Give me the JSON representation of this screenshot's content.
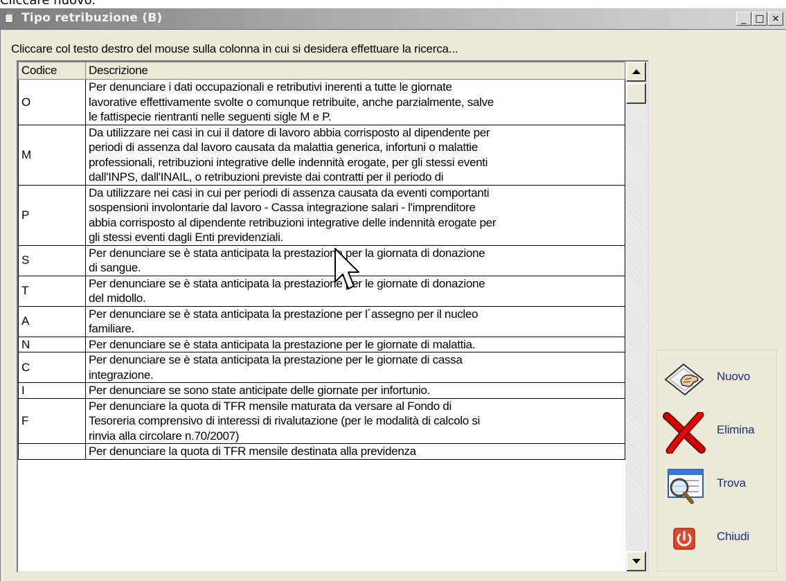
{
  "outer_caption": "Cliccare nuovo.",
  "window": {
    "title": "Tipo retribuzione (B)",
    "controls": {
      "minimize": "_",
      "maximize": "□",
      "close": "×"
    }
  },
  "hint": "Cliccare col testo destro del mouse sulla colonna in cui si desidera effettuare la ricerca...",
  "grid": {
    "columns": [
      "Codice",
      "Descrizione"
    ],
    "rows": [
      {
        "code": "O",
        "desc": [
          "Per denunciare i dati occupazionali e retributivi inerenti a tutte le giornate",
          "lavorative effettivamente svolte o comunque retribuite, anche parzialmente, salve",
          "le fattispecie rientranti nelle seguenti sigle M e P."
        ]
      },
      {
        "code": "M",
        "desc": [
          "Da utilizzare nei casi in cui il datore di lavoro abbia corrisposto al dipendente per",
          "periodi di assenza dal lavoro causata da malattia generica, infortuni o malattie",
          "professionali, retribuzioni integrative delle indennità erogate, per gli stessi eventi",
          "dall'INPS, dall'INAIL, o retribuzioni previste dai contratti per il periodo di"
        ]
      },
      {
        "code": "P",
        "desc": [
          "Da utilizzare nei casi in cui per periodi di assenza causata da eventi comportanti",
          "sospensioni involontarie dal lavoro - Cassa integrazione salari - l'imprenditore",
          "abbia corrisposto al dipendente retribuzioni integrative delle indennità erogate per",
          "gli stessi eventi dagli Enti previdenziali."
        ]
      },
      {
        "code": "S",
        "desc": [
          "Per denunciare se è stata anticipata la prestazione per la giornata di donazione",
          "di sangue."
        ]
      },
      {
        "code": "T",
        "desc": [
          "Per denunciare se è stata anticipata la prestazione per le giornate di donazione",
          "del midollo."
        ]
      },
      {
        "code": "A",
        "desc": [
          "Per denunciare se è stata anticipata la prestazione per l´assegno per il nucleo",
          "familiare."
        ]
      },
      {
        "code": "N",
        "desc": [
          "Per denunciare se è stata anticipata la prestazione per le giornate di malattia."
        ]
      },
      {
        "code": "C",
        "desc": [
          "Per denunciare se è stata anticipata la prestazione per le giornate di cassa",
          "integrazione."
        ]
      },
      {
        "code": "I",
        "desc": [
          "Per denunciare se sono state anticipate delle giornate per infortunio."
        ]
      },
      {
        "code": "F",
        "desc": [
          "Per denunciare la quota di TFR mensile maturata da versare al Fondo di",
          "Tesoreria comprensivo di interessi di rivalutazione (per le modalità di calcolo si",
          "rinvia alla circolare n.70/2007)"
        ]
      },
      {
        "code": "",
        "desc": [
          "Per denunciare la quota di TFR mensile destinata alla previdenza"
        ]
      }
    ]
  },
  "actions": [
    {
      "name": "nuovo",
      "label": "Nuovo",
      "icon": "hand-card-icon"
    },
    {
      "name": "elimina",
      "label": "Elimina",
      "icon": "red-x-icon"
    },
    {
      "name": "trova",
      "label": "Trova",
      "icon": "magnifier-icon"
    },
    {
      "name": "chiudi",
      "label": "Chiudi",
      "icon": "power-icon"
    }
  ],
  "colors": {
    "action_label": "#1b2e7a",
    "window_bg": "#ece9d8",
    "elimina_x": "#d40000",
    "chiudi": "#e2462a"
  }
}
